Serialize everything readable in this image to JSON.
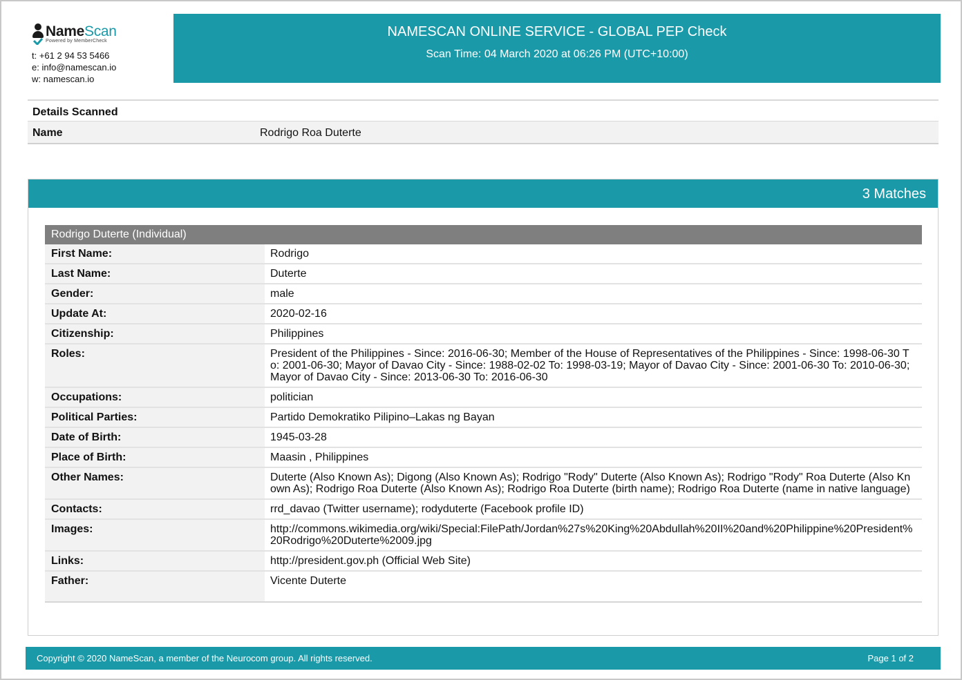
{
  "header": {
    "logo_name_a": "Name",
    "logo_name_b": "Scan",
    "logo_tagline": "Powered by MemberCheck",
    "phone": "t: +61 2 94 53 5466",
    "email": "e: info@namescan.io",
    "web": "w: namescan.io",
    "title": "NAMESCAN ONLINE SERVICE - GLOBAL PEP Check",
    "scan_time": "Scan Time: 04 March 2020 at 06:26 PM (UTC+10:00)"
  },
  "details": {
    "heading": "Details Scanned",
    "name_label": "Name",
    "name_value": "Rodrigo Roa Duterte"
  },
  "matches": {
    "count_label": "3 Matches",
    "record": {
      "title": "Rodrigo Duterte (Individual)",
      "fields": [
        {
          "label": "First Name:",
          "value": "Rodrigo"
        },
        {
          "label": "Last Name:",
          "value": "Duterte"
        },
        {
          "label": "Gender:",
          "value": "male"
        },
        {
          "label": "Update At:",
          "value": "2020-02-16"
        },
        {
          "label": "Citizenship:",
          "value": "Philippines"
        },
        {
          "label": "Roles:",
          "value": "President of the Philippines - Since: 2016-06-30; Member of the House of Representatives of the Philippines - Since: 1998-06-30 To: 2001-06-30; Mayor of Davao City - Since: 1988-02-02 To: 1998-03-19; Mayor of Davao City - Since: 2001-06-30 To: 2010-06-30; Mayor of Davao City - Since: 2013-06-30 To: 2016-06-30"
        },
        {
          "label": "Occupations:",
          "value": "politician"
        },
        {
          "label": "Political Parties:",
          "value": "Partido Demokratiko Pilipino–Lakas ng Bayan"
        },
        {
          "label": "Date of Birth:",
          "value": "1945-03-28"
        },
        {
          "label": "Place of Birth:",
          "value": "Maasin , Philippines"
        },
        {
          "label": "Other Names:",
          "value": "Duterte (Also Known As); Digong (Also Known As); Rodrigo \"Rody\" Duterte (Also Known As); Rodrigo \"Rody\" Roa Duterte (Also Known As); Rodrigo Roa Duterte (Also Known As); Rodrigo Roa Duterte (birth name); Rodrigo Roa Duterte (name in native language)"
        },
        {
          "label": "Contacts:",
          "value": "rrd_davao (Twitter username); rodyduterte (Facebook profile ID)"
        },
        {
          "label": "Images:",
          "value": "http://commons.wikimedia.org/wiki/Special:FilePath/Jordan%27s%20King%20Abdullah%20II%20and%20Philippine%20President%20Rodrigo%20Duterte%2009.jpg"
        },
        {
          "label": "Links:",
          "value": "http://president.gov.ph (Official Web Site)"
        },
        {
          "label": "Father:",
          "value": "Vicente Duterte"
        }
      ]
    }
  },
  "footer": {
    "copyright": "Copyright © 2020 NameScan, a member of the Neurocom group. All rights reserved.",
    "page": "Page 1 of 2"
  },
  "colors": {
    "brand_teal": "#1a9aa8",
    "record_header_gray": "#7f7f7f",
    "label_column_bg": "#f2f2f2"
  }
}
